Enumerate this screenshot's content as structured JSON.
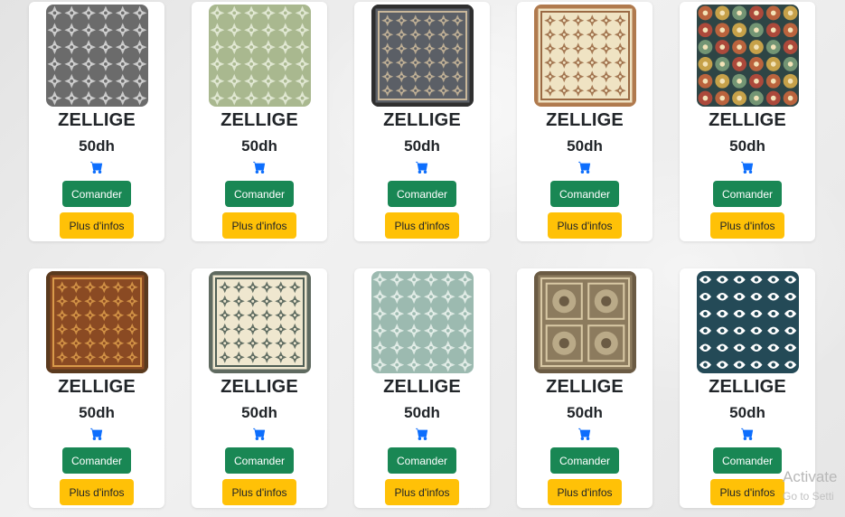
{
  "products": [
    {
      "name": "ZELLIGE",
      "price": "50dh",
      "order_label": "Comander",
      "info_label": "Plus d'infos",
      "icon": "cart-icon",
      "palette": {
        "base": "#6b6b6b",
        "accent": "#d8d8d8",
        "border": "#5a5a5a"
      }
    },
    {
      "name": "ZELLIGE",
      "price": "50dh",
      "order_label": "Comander",
      "info_label": "Plus d'infos",
      "icon": "cart-icon",
      "palette": {
        "base": "#a9b88f",
        "accent": "#e6ecd9",
        "border": "#97a87c"
      }
    },
    {
      "name": "ZELLIGE",
      "price": "50dh",
      "order_label": "Comander",
      "info_label": "Plus d'infos",
      "icon": "cart-icon",
      "palette": {
        "base": "#5b5f66",
        "accent": "#c9b79a",
        "border": "#2f2f2f"
      }
    },
    {
      "name": "ZELLIGE",
      "price": "50dh",
      "order_label": "Comander",
      "info_label": "Plus d'infos",
      "icon": "cart-icon",
      "palette": {
        "base": "#efe3c3",
        "accent": "#9a6a44",
        "border": "#b07a4e"
      }
    },
    {
      "name": "ZELLIGE",
      "price": "50dh",
      "order_label": "Comander",
      "info_label": "Plus d'infos",
      "icon": "cart-icon",
      "palette": {
        "base": "#2e4545",
        "accent": "#d2693c",
        "border": "#2e4545"
      }
    },
    {
      "name": "ZELLIGE",
      "price": "50dh",
      "order_label": "Comander",
      "info_label": "Plus d'infos",
      "icon": "cart-icon",
      "palette": {
        "base": "#8a4a23",
        "accent": "#d99a4a",
        "border": "#5a3a1e"
      }
    },
    {
      "name": "ZELLIGE",
      "price": "50dh",
      "order_label": "Comander",
      "info_label": "Plus d'infos",
      "icon": "cart-icon",
      "palette": {
        "base": "#efe7cf",
        "accent": "#4f5e55",
        "border": "#5f6a60"
      }
    },
    {
      "name": "ZELLIGE",
      "price": "50dh",
      "order_label": "Comander",
      "info_label": "Plus d'infos",
      "icon": "cart-icon",
      "palette": {
        "base": "#9cbab0",
        "accent": "#e9f1ec",
        "border": "#9cbab0"
      }
    },
    {
      "name": "ZELLIGE",
      "price": "50dh",
      "order_label": "Comander",
      "info_label": "Plus d'infos",
      "icon": "cart-icon",
      "palette": {
        "base": "#8c7b5e",
        "accent": "#d9c9a5",
        "border": "#6b5b44"
      }
    },
    {
      "name": "ZELLIGE",
      "price": "50dh",
      "order_label": "Comander",
      "info_label": "Plus d'infos",
      "icon": "cart-icon",
      "palette": {
        "base": "#244a57",
        "accent": "#ffffff",
        "border": "#244a57"
      }
    }
  ],
  "colors": {
    "order_button": "#198754",
    "info_button": "#ffc107",
    "cart_icon": "#0d6efd"
  },
  "watermark": {
    "line1": "Activate",
    "line2": "Go to Setti"
  }
}
